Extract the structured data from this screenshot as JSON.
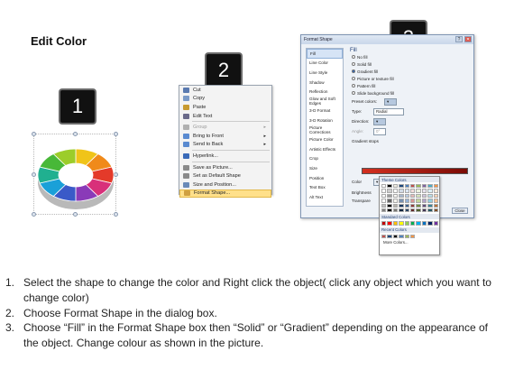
{
  "title": "Edit Color",
  "steps": [
    "1",
    "2",
    "3"
  ],
  "ring": {
    "colors": [
      "#f0c419",
      "#f08a1a",
      "#e43a2a",
      "#d8307a",
      "#8a3ab8",
      "#3a5ac8",
      "#1aa0d8",
      "#20b090",
      "#48b838",
      "#9ccd2a"
    ]
  },
  "context_menu": {
    "items": [
      {
        "label": "Cut",
        "enabled": true,
        "icon_color": "#5a7ab0"
      },
      {
        "label": "Copy",
        "enabled": true,
        "icon_color": "#7a9ac8"
      },
      {
        "label": "Paste",
        "enabled": true,
        "icon_color": "#c89a30"
      },
      {
        "label": "Edit Text",
        "enabled": true,
        "icon_color": "#6a6a8a"
      },
      {
        "label": "Group",
        "enabled": false,
        "submenu": true,
        "icon_color": "#b0b0b0"
      },
      {
        "label": "Bring to Front",
        "enabled": true,
        "submenu": true,
        "icon_color": "#5a8ad0"
      },
      {
        "label": "Send to Back",
        "enabled": true,
        "submenu": true,
        "icon_color": "#5a8ad0"
      },
      {
        "label": "Hyperlink...",
        "enabled": true,
        "icon_color": "#3a6ab8"
      },
      {
        "label": "Save as Picture...",
        "enabled": true,
        "icon_color": "#8a8a8a"
      },
      {
        "label": "Set as Default Shape",
        "enabled": true,
        "icon_color": "#8a8a8a"
      },
      {
        "label": "Size and Position...",
        "enabled": true,
        "icon_color": "#6a8ab8"
      },
      {
        "label": "Format Shape...",
        "enabled": true,
        "highlighted": true,
        "icon_color": "#d0a040"
      }
    ]
  },
  "dialog": {
    "title": "Format Shape",
    "categories": [
      "Fill",
      "Line Color",
      "Line Style",
      "Shadow",
      "Reflection",
      "Glow and Soft Edges",
      "3-D Format",
      "3-D Rotation",
      "Picture Corrections",
      "Picture Color",
      "Artistic Effects",
      "Crop",
      "Size",
      "Position",
      "Text Box",
      "Alt Text"
    ],
    "selected_category": "Fill",
    "fill_heading": "Fill",
    "fill_options": [
      "No fill",
      "Solid fill",
      "Gradient fill",
      "Picture or texture fill",
      "Pattern fill",
      "Slide background fill"
    ],
    "selected_fill": "Gradient fill",
    "preset_colors_label": "Preset colors:",
    "type_label": "Type:",
    "type_value": "Radial",
    "direction_label": "Direction:",
    "angle_label": "Angle:",
    "angle_value": "0°",
    "gradient_stops_label": "Gradient stops",
    "color_label": "Color",
    "position_label": "Position:",
    "position_value": "0%",
    "brightness_label": "Brightness",
    "transparency_label": "Transpare",
    "rotate_label": "Rotate",
    "close_label": "Close"
  },
  "color_picker": {
    "theme_colors_label": "Theme Colors",
    "standard_colors_label": "Standard Colors",
    "recent_colors_label": "Recent Colors",
    "more_colors_label": "More Colors...",
    "theme_top": [
      "#ffffff",
      "#000000",
      "#eeece1",
      "#1f497d",
      "#4f81bd",
      "#c0504d",
      "#9bbb59",
      "#8064a2",
      "#4bacc6",
      "#f79646"
    ],
    "standard": [
      "#c00000",
      "#ff0000",
      "#ffc000",
      "#ffff00",
      "#92d050",
      "#00b050",
      "#00b0f0",
      "#0070c0",
      "#002060",
      "#7030a0"
    ],
    "recent": [
      "#c0504d",
      "#1f497d",
      "#000000",
      "#4f81bd",
      "#9bbb59",
      "#f79646"
    ]
  },
  "instructions": [
    {
      "num": "1.",
      "text": "Select the shape to change the color and Right click the object( click any object which you want to change color)"
    },
    {
      "num": "2.",
      "text": "Choose Format Shape in the dialog box."
    },
    {
      "num": "3.",
      "text": "Choose “Fill” in the Format Shape box then “Solid” or “Gradient” depending on the appearance of the object. Change colour as shown in the picture."
    }
  ]
}
